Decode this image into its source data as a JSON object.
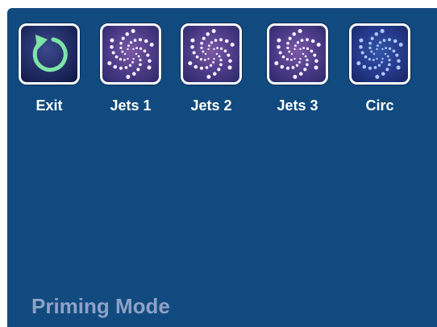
{
  "buttons": [
    {
      "id": "exit",
      "label": "Exit",
      "icon": "exit-arrow-icon"
    },
    {
      "id": "jets1",
      "label": "Jets 1",
      "icon": "jets-pinwheel-icon"
    },
    {
      "id": "jets2",
      "label": "Jets 2",
      "icon": "jets-pinwheel-icon"
    },
    {
      "id": "jets3",
      "label": "Jets 3",
      "icon": "jets-pinwheel-icon"
    },
    {
      "id": "circ",
      "label": "Circ",
      "icon": "circ-pinwheel-icon"
    }
  ],
  "mode_title": "Priming Mode",
  "colors": {
    "background": "#114a7e",
    "label": "#ffffff",
    "mode_title": "#8ea2c7",
    "exit_arrow": "#7ee3a6"
  }
}
